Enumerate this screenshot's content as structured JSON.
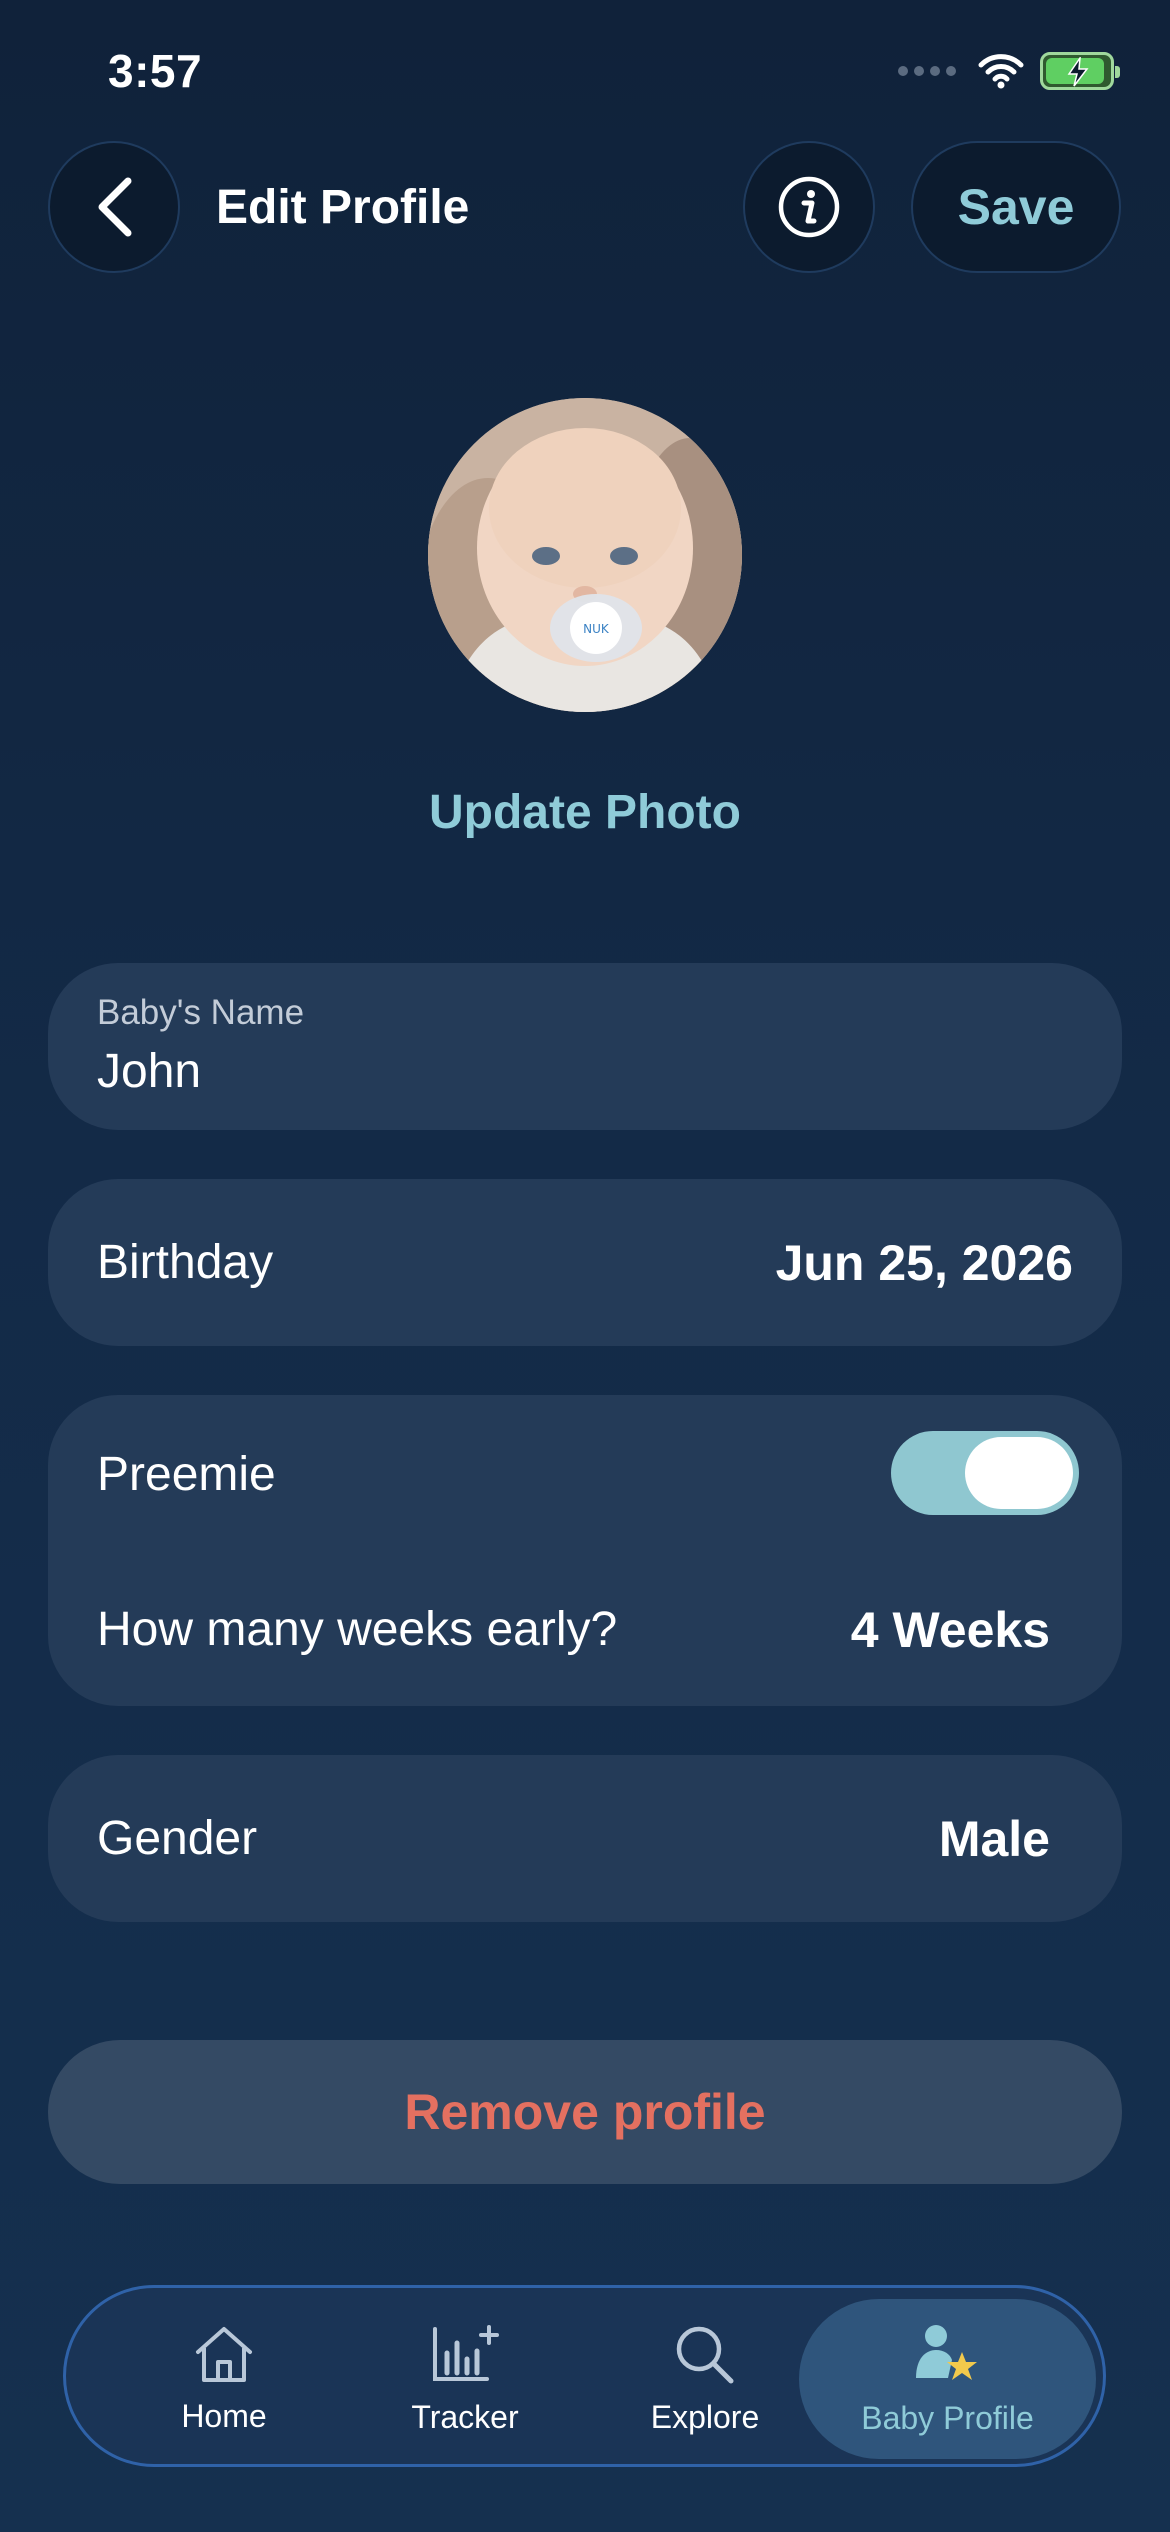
{
  "status_bar": {
    "time": "3:57"
  },
  "header": {
    "title": "Edit Profile",
    "save_label": "Save"
  },
  "avatar": {
    "update_label": "Update Photo"
  },
  "form": {
    "name": {
      "label": "Baby's Name",
      "value": "John"
    },
    "birthday": {
      "label": "Birthday",
      "value": "Jun 25, 2026"
    },
    "preemie": {
      "label": "Preemie",
      "enabled": true,
      "weeks_label": "How many weeks early?",
      "weeks_value": "4 Weeks"
    },
    "gender": {
      "label": "Gender",
      "value": "Male"
    }
  },
  "remove_label": "Remove profile",
  "tabs": [
    {
      "label": "Home",
      "icon": "home-icon",
      "active": false
    },
    {
      "label": "Tracker",
      "icon": "chart-plus-icon",
      "active": false
    },
    {
      "label": "Explore",
      "icon": "search-icon",
      "active": false
    },
    {
      "label": "Baby Profile",
      "icon": "baby-profile-icon",
      "active": true
    }
  ],
  "colors": {
    "accent": "#8fcbd8",
    "danger": "#e47060",
    "card": "#243b58",
    "background": "#132a47"
  }
}
